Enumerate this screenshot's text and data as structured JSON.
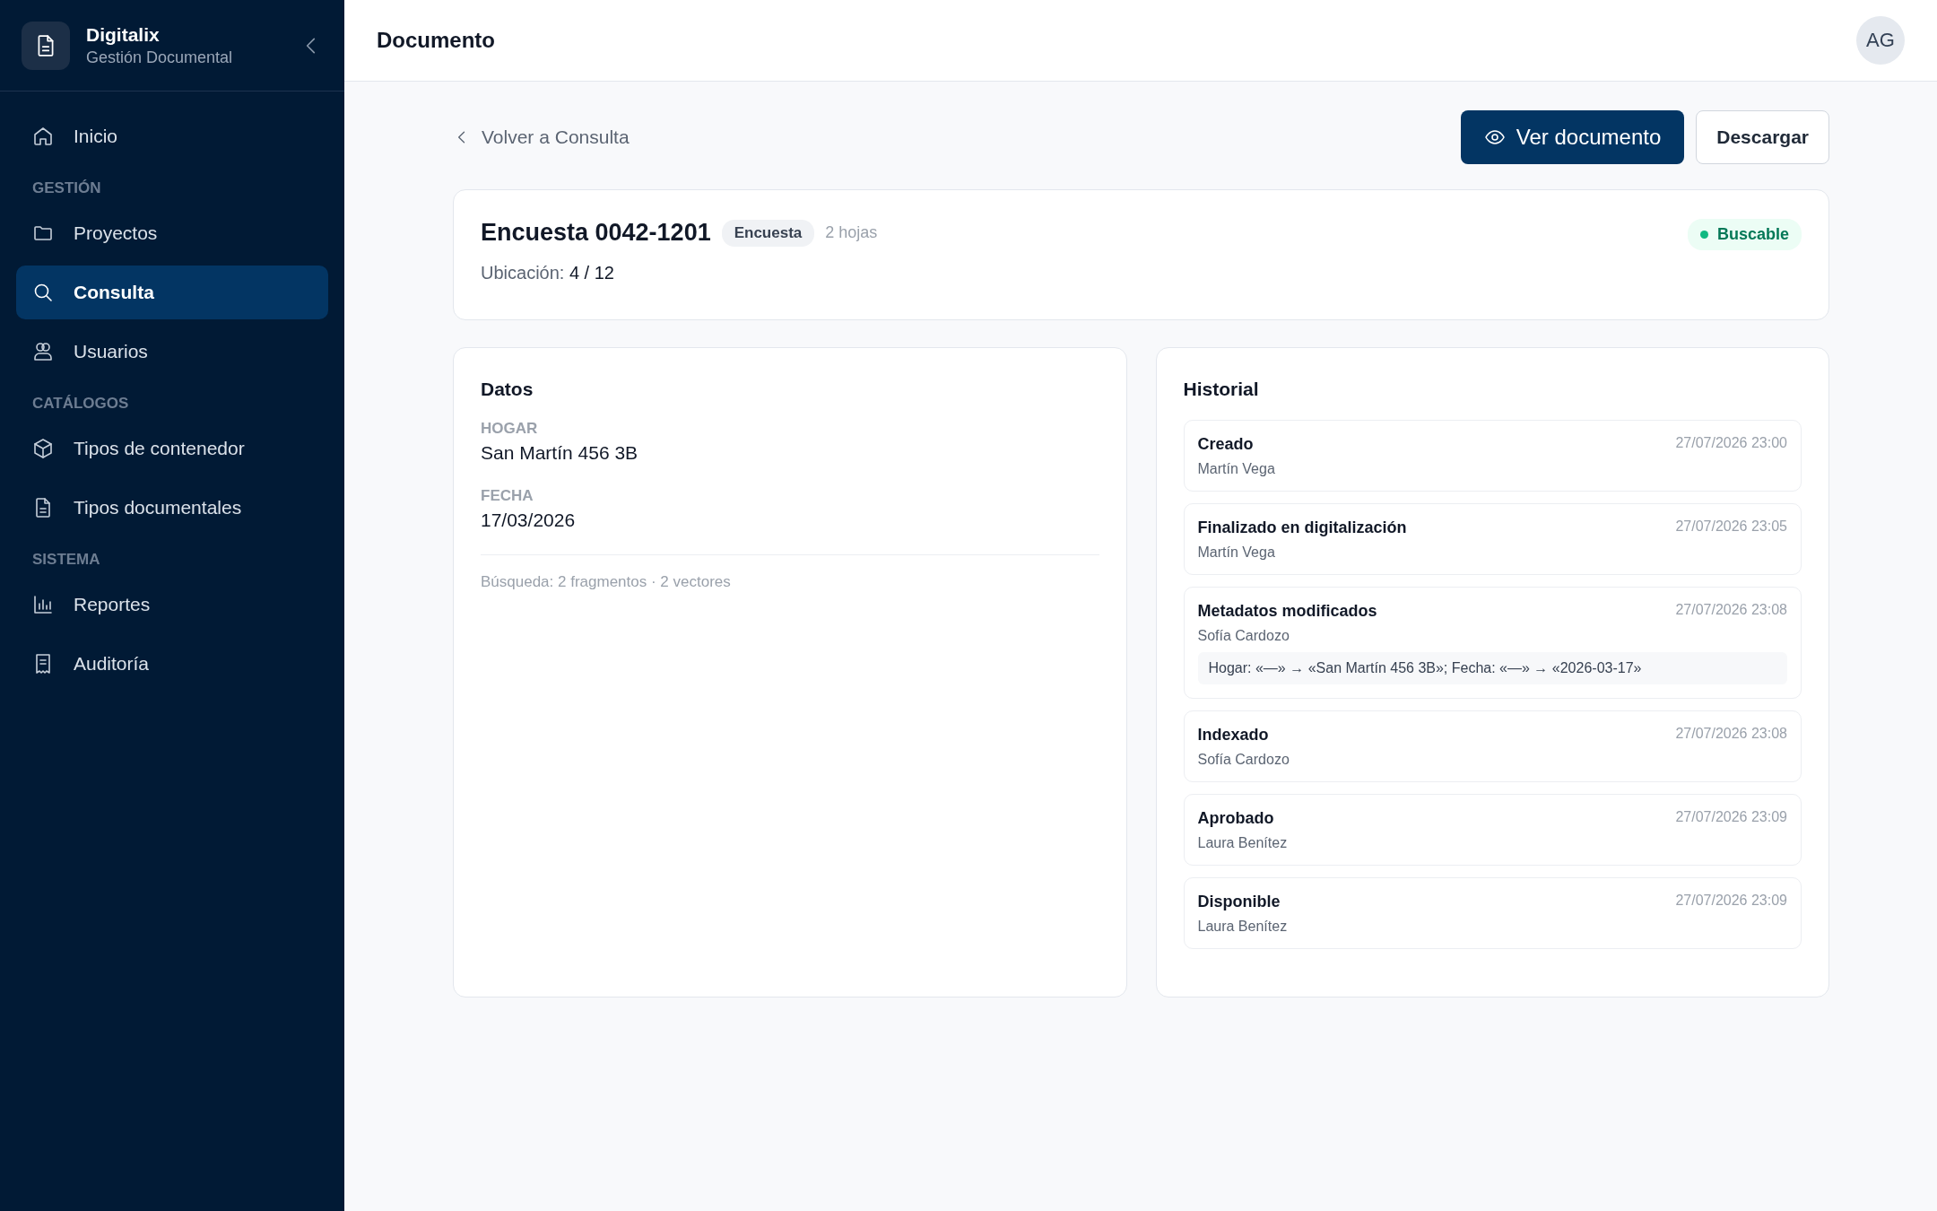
{
  "sidebar": {
    "brand": {
      "name": "Digitalix",
      "subtitle": "Gestión Documental"
    },
    "groups": [
      {
        "items": [
          {
            "label": "Inicio",
            "selected": false
          }
        ]
      },
      {
        "section": "GESTIÓN",
        "items": [
          {
            "label": "Proyectos",
            "selected": false
          },
          {
            "label": "Consulta",
            "selected": true
          },
          {
            "label": "Usuarios",
            "selected": false
          }
        ]
      },
      {
        "section": "CATÁLOGOS",
        "items": [
          {
            "label": "Tipos de contenedor",
            "selected": false
          },
          {
            "label": "Tipos documentales",
            "selected": false
          }
        ]
      },
      {
        "section": "SISTEMA",
        "items": [
          {
            "label": "Reportes",
            "selected": false
          },
          {
            "label": "Auditoría",
            "selected": false
          }
        ]
      }
    ]
  },
  "header": {
    "title": "Documento",
    "avatar": "AG"
  },
  "back_link": "Volver a Consulta",
  "actions": [
    {
      "label": "Ver documento",
      "kind": "primary"
    },
    {
      "label": "Descargar",
      "kind": "secondary"
    }
  ],
  "document": {
    "title": "Encuesta 0042-1201",
    "type_badge": "Encuesta",
    "pages": "2 hojas",
    "location_label": "Ubicación:",
    "location": "4 / 12",
    "status": "Buscable"
  },
  "data_card": {
    "title": "Datos",
    "fields": [
      {
        "label": "HOGAR",
        "value": "San Martín 456 3B"
      },
      {
        "label": "FECHA",
        "value": "17/03/2026"
      }
    ],
    "footer": "Búsqueda: 2 fragmentos · 2 vectores"
  },
  "history": {
    "title": "Historial",
    "entries": [
      {
        "event": "Creado",
        "user": "Martín Vega",
        "time": "27/07/2026 23:00"
      },
      {
        "event": "Finalizado en digitalización",
        "user": "Martín Vega",
        "time": "27/07/2026 23:05"
      },
      {
        "event": "Metadatos modificados",
        "user": "Sofía Cardozo",
        "time": "27/07/2026 23:08",
        "detail": "Hogar: «—» → «San Martín 456 3B»; Fecha: «—» → «2026-03-17»"
      },
      {
        "event": "Indexado",
        "user": "Sofía Cardozo",
        "time": "27/07/2026 23:08"
      },
      {
        "event": "Aprobado",
        "user": "Laura Benítez",
        "time": "27/07/2026 23:09"
      },
      {
        "event": "Disponible",
        "user": "Laura Benítez",
        "time": "27/07/2026 23:09"
      }
    ]
  }
}
